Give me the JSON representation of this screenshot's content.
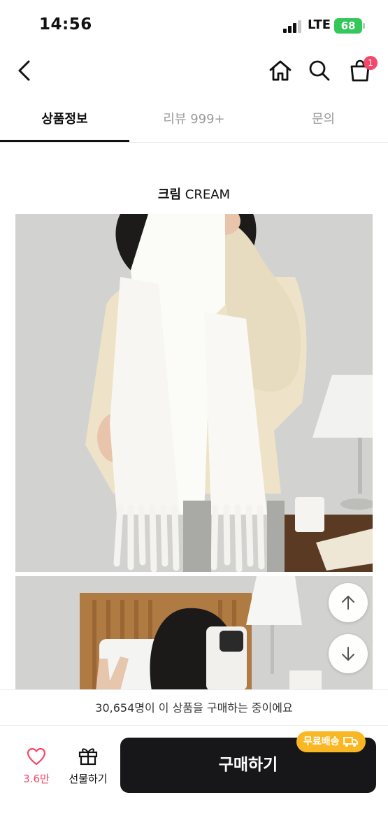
{
  "status_bar": {
    "time": "14:56",
    "network": "LTE",
    "battery": "68"
  },
  "nav": {
    "cart_count": "1",
    "back_icon": "chevron-left-icon",
    "home_icon": "home-icon",
    "search_icon": "search-icon",
    "cart_icon": "shopping-bag-icon"
  },
  "tabs": [
    {
      "label": "상품정보",
      "active": true
    },
    {
      "label": "리뷰 999+"
    },
    {
      "label": "문의"
    }
  ],
  "content": {
    "color_name_ko": "크림",
    "color_name_en": "CREAM"
  },
  "float_buttons": {
    "up_icon": "arrow-up-icon",
    "down_icon": "arrow-down-icon"
  },
  "banner": {
    "text": "30,654명이 이 상품을 구매하는 중이에요"
  },
  "bottom": {
    "like_count": "3.6만",
    "gift_label": "선물하기",
    "buy_label": "구매하기",
    "free_shipping": "무료배송"
  },
  "colors": {
    "accent_pink": "#f5476a",
    "badge_yellow": "#f9b724",
    "buy_button": "#17171a",
    "battery_green": "#34c759"
  }
}
